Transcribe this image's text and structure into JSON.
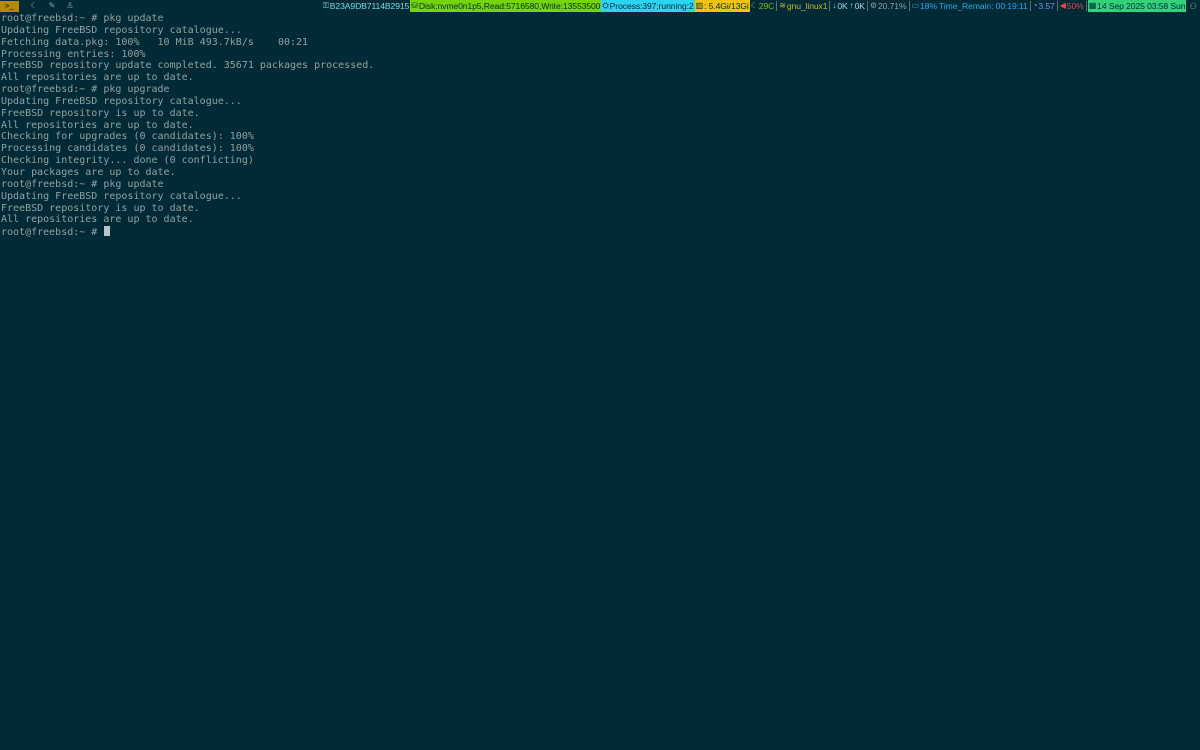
{
  "taskbar": {
    "terminal_button_label": ">_",
    "workspaces": [
      {
        "icon": "moon-icon",
        "glyph": "☾"
      },
      {
        "icon": "pen-icon",
        "glyph": "✎"
      },
      {
        "icon": "penguin-icon",
        "glyph": "♙"
      }
    ]
  },
  "statusbar": {
    "uuid": "B23A9DB7114B2915",
    "disk": "Disk:nvme0n1p5,Read:5716580,Write:13553500",
    "process": "Process:397;running:2",
    "memory": ": 5.4Gi/13Gi",
    "temperature": "29C",
    "network_name": "gnu_linux1",
    "download": "0K",
    "upload": "0K",
    "cpu": "20.71%",
    "battery": "18% Time_Remain: 00:19:11",
    "load": "3.57",
    "volume": "50%",
    "date": "14 Sep 2025 03:58 Sun",
    "colors": {
      "disk_bg": "#76d40c",
      "process_bg": "#2bd5f2",
      "memory_bg": "#f2c40f",
      "date_bg": "#33d17a",
      "volume": "#e34b4b",
      "battery": "#2aa8e8"
    }
  },
  "terminal": {
    "lines": [
      "root@freebsd:~ # pkg update",
      "Updating FreeBSD repository catalogue...",
      "Fetching data.pkg: 100%   10 MiB 493.7kB/s    00:21",
      "Processing entries: 100%",
      "FreeBSD repository update completed. 35671 packages processed.",
      "All repositories are up to date.",
      "root@freebsd:~ # pkg upgrade",
      "Updating FreeBSD repository catalogue...",
      "FreeBSD repository is up to date.",
      "All repositories are up to date.",
      "Checking for upgrades (0 candidates): 100%",
      "Processing candidates (0 candidates): 100%",
      "Checking integrity... done (0 conflicting)",
      "Your packages are up to date.",
      "root@freebsd:~ # pkg update",
      "Updating FreeBSD repository catalogue...",
      "FreeBSD repository is up to date.",
      "All repositories are up to date."
    ],
    "prompt": "root@freebsd:~ # ",
    "background": "#002b36",
    "foreground": "#93a1a1"
  }
}
